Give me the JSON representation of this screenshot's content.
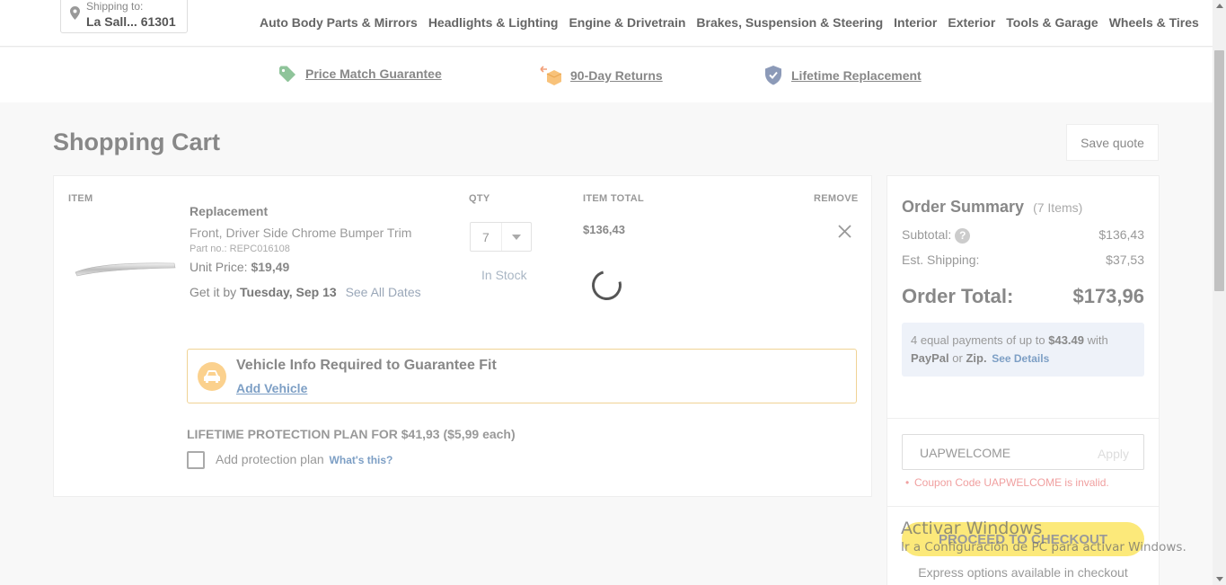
{
  "header": {
    "shipping_label": "Shipping to:",
    "shipping_location": "La Sall... 61301",
    "nav": [
      "Auto Body Parts & Mirrors",
      "Headlights & Lighting",
      "Engine & Drivetrain",
      "Brakes, Suspension & Steering",
      "Interior",
      "Exterior",
      "Tools & Garage",
      "Wheels & Tires"
    ]
  },
  "guarantees": {
    "price_match": "Price Match Guarantee",
    "returns": "90-Day Returns",
    "lifetime": "Lifetime Replacement"
  },
  "page": {
    "title": "Shopping Cart",
    "save_quote": "Save quote"
  },
  "cart": {
    "headers": {
      "item": "ITEM",
      "qty": "QTY",
      "item_total": "ITEM TOTAL",
      "remove": "REMOVE"
    },
    "item": {
      "name": "Replacement",
      "description": "Front, Driver Side Chrome Bumper Trim",
      "part_no": "Part no.: REPC016108",
      "unit_price_label": "Unit Price:",
      "unit_price": "$19,49",
      "get_it_by": "Get it by",
      "delivery_date": "Tuesday, Sep 13",
      "see_all_dates": "See All Dates",
      "qty": "7",
      "stock": "In Stock",
      "item_total": "$136,43"
    },
    "vehicle_info": {
      "heading": "Vehicle Info Required to Guarantee Fit",
      "link": "Add Vehicle"
    },
    "protection": {
      "heading": "LIFETIME PROTECTION PLAN FOR $41,93 ($5,99 each)",
      "label": "Add protection plan",
      "whats_this": "What's this?"
    }
  },
  "summary": {
    "title": "Order Summary",
    "count": "(7 Items)",
    "subtotal_label": "Subtotal:",
    "subtotal": "$136,43",
    "shipping_label": "Est. Shipping:",
    "shipping": "$37,53",
    "total_label": "Order Total:",
    "total": "$173,96",
    "pay_pre": "4 equal payments of up to",
    "pay_amount": "$43.49",
    "pay_with": "with",
    "pay_paypal": "PayPal",
    "pay_or": "or",
    "pay_zip": "Zip.",
    "pay_details": "See Details",
    "coupon_value": "UAPWELCOME",
    "apply": "Apply",
    "coupon_error": "Coupon Code UAPWELCOME is invalid.",
    "checkout": "PROCEED TO CHECKOUT",
    "express": "Express options available in checkout"
  },
  "watermark": {
    "line1": "Activar Windows",
    "line2": "Ir a Configuración de PC para activar Windows."
  },
  "colors": {
    "accent_link": "#7d9fc5",
    "checkout": "#fce97a",
    "vehicle_border": "#f0d395"
  }
}
